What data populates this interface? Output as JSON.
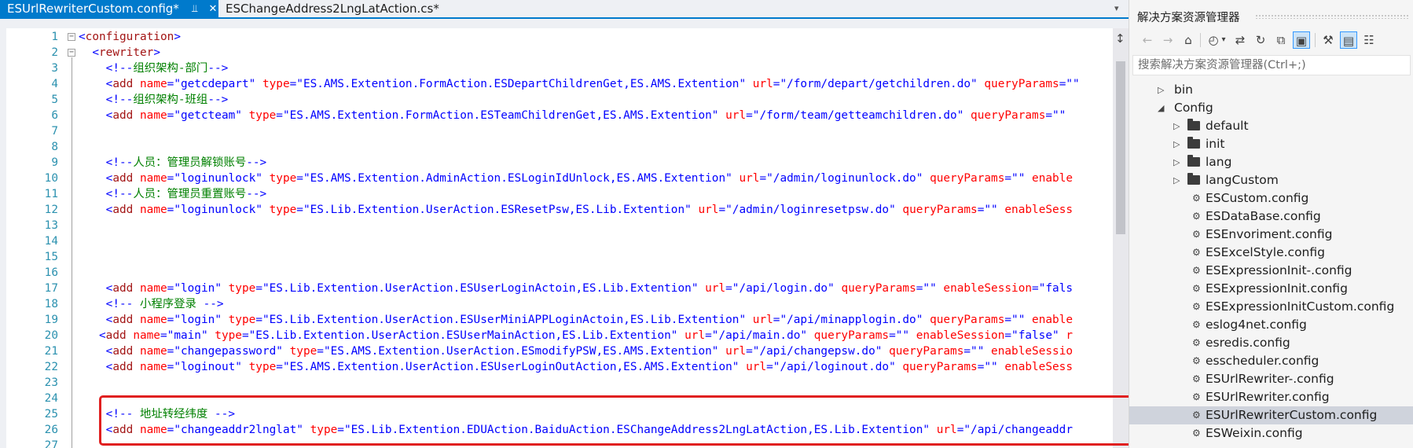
{
  "tabs": [
    {
      "label": "ESUrlRewriterCustom.config*",
      "pin_icon": "pin-icon",
      "close_icon": "close-icon",
      "active": true
    },
    {
      "label": "ESChangeAddress2LngLatAction.cs*",
      "active": false
    }
  ],
  "editor": {
    "lines": [
      {
        "n": "1",
        "parts": [
          [
            "brk",
            "<"
          ],
          [
            "tag",
            "configuration"
          ],
          [
            "brk",
            ">"
          ]
        ]
      },
      {
        "n": "2",
        "parts": [
          [
            "brk",
            "  <"
          ],
          [
            "tag",
            "rewriter"
          ],
          [
            "brk",
            ">"
          ]
        ]
      },
      {
        "n": "3",
        "parts": [
          [
            "brk",
            "    <!--"
          ],
          [
            "cmt",
            "组织架构-部门"
          ],
          [
            "brk",
            "-->"
          ]
        ]
      },
      {
        "n": "4",
        "parts": [
          [
            "brk",
            "    <"
          ],
          [
            "tag",
            "add"
          ],
          [
            "attr",
            " name"
          ],
          [
            "brk",
            "=\""
          ],
          [
            "val",
            "getcdepart"
          ],
          [
            "brk",
            "\""
          ],
          [
            "attr",
            " type"
          ],
          [
            "brk",
            "=\""
          ],
          [
            "val",
            "ES.AMS.Extention.FormAction.ESDepartChildrenGet,ES.AMS.Extention"
          ],
          [
            "brk",
            "\""
          ],
          [
            "attr",
            " url"
          ],
          [
            "brk",
            "=\""
          ],
          [
            "val",
            "/form/depart/getchildren.do"
          ],
          [
            "brk",
            "\""
          ],
          [
            "attr",
            " queryParams"
          ],
          [
            "brk",
            "=\"\""
          ]
        ]
      },
      {
        "n": "5",
        "parts": [
          [
            "brk",
            "    <!--"
          ],
          [
            "cmt",
            "组织架构-班组"
          ],
          [
            "brk",
            "-->"
          ]
        ]
      },
      {
        "n": "6",
        "parts": [
          [
            "brk",
            "    <"
          ],
          [
            "tag",
            "add"
          ],
          [
            "attr",
            " name"
          ],
          [
            "brk",
            "=\""
          ],
          [
            "val",
            "getcteam"
          ],
          [
            "brk",
            "\""
          ],
          [
            "attr",
            " type"
          ],
          [
            "brk",
            "=\""
          ],
          [
            "val",
            "ES.AMS.Extention.FormAction.ESTeamChildrenGet,ES.AMS.Extention"
          ],
          [
            "brk",
            "\""
          ],
          [
            "attr",
            " url"
          ],
          [
            "brk",
            "=\""
          ],
          [
            "val",
            "/form/team/getteamchildren.do"
          ],
          [
            "brk",
            "\""
          ],
          [
            "attr",
            " queryParams"
          ],
          [
            "brk",
            "=\"\""
          ]
        ]
      },
      {
        "n": "7",
        "parts": []
      },
      {
        "n": "8",
        "parts": []
      },
      {
        "n": "9",
        "parts": [
          [
            "brk",
            "    <!--"
          ],
          [
            "cmt",
            "人员：管理员解锁账号"
          ],
          [
            "brk",
            "-->"
          ]
        ]
      },
      {
        "n": "10",
        "parts": [
          [
            "brk",
            "    <"
          ],
          [
            "tag",
            "add"
          ],
          [
            "attr",
            " name"
          ],
          [
            "brk",
            "=\""
          ],
          [
            "val",
            "loginunlock"
          ],
          [
            "brk",
            "\""
          ],
          [
            "attr",
            " type"
          ],
          [
            "brk",
            "=\""
          ],
          [
            "val",
            "ES.AMS.Extention.AdminAction.ESLoginIdUnlock,ES.AMS.Extention"
          ],
          [
            "brk",
            "\""
          ],
          [
            "attr",
            " url"
          ],
          [
            "brk",
            "=\""
          ],
          [
            "val",
            "/admin/loginunlock.do"
          ],
          [
            "brk",
            "\""
          ],
          [
            "attr",
            " queryParams"
          ],
          [
            "brk",
            "=\"\""
          ],
          [
            "attr",
            " enable"
          ]
        ]
      },
      {
        "n": "11",
        "parts": [
          [
            "brk",
            "    <!--"
          ],
          [
            "cmt",
            "人员：管理员重置账号"
          ],
          [
            "brk",
            "-->"
          ]
        ]
      },
      {
        "n": "12",
        "parts": [
          [
            "brk",
            "    <"
          ],
          [
            "tag",
            "add"
          ],
          [
            "attr",
            " name"
          ],
          [
            "brk",
            "=\""
          ],
          [
            "val",
            "loginunlock"
          ],
          [
            "brk",
            "\""
          ],
          [
            "attr",
            " type"
          ],
          [
            "brk",
            "=\""
          ],
          [
            "val",
            "ES.Lib.Extention.UserAction.ESResetPsw,ES.Lib.Extention"
          ],
          [
            "brk",
            "\""
          ],
          [
            "attr",
            " url"
          ],
          [
            "brk",
            "=\""
          ],
          [
            "val",
            "/admin/loginresetpsw.do"
          ],
          [
            "brk",
            "\""
          ],
          [
            "attr",
            " queryParams"
          ],
          [
            "brk",
            "=\"\""
          ],
          [
            "attr",
            " enableSess"
          ]
        ]
      },
      {
        "n": "13",
        "parts": []
      },
      {
        "n": "14",
        "parts": []
      },
      {
        "n": "15",
        "parts": []
      },
      {
        "n": "16",
        "parts": []
      },
      {
        "n": "17",
        "parts": [
          [
            "brk",
            "    <"
          ],
          [
            "tag",
            "add"
          ],
          [
            "attr",
            " name"
          ],
          [
            "brk",
            "=\""
          ],
          [
            "val",
            "login"
          ],
          [
            "brk",
            "\""
          ],
          [
            "attr",
            " type"
          ],
          [
            "brk",
            "=\""
          ],
          [
            "val",
            "ES.Lib.Extention.UserAction.ESUserLoginActoin,ES.Lib.Extention"
          ],
          [
            "brk",
            "\""
          ],
          [
            "attr",
            " url"
          ],
          [
            "brk",
            "=\""
          ],
          [
            "val",
            "/api/login.do"
          ],
          [
            "brk",
            "\""
          ],
          [
            "attr",
            " queryParams"
          ],
          [
            "brk",
            "=\"\""
          ],
          [
            "attr",
            " enableSession"
          ],
          [
            "brk",
            "=\""
          ],
          [
            "val",
            "fals"
          ]
        ]
      },
      {
        "n": "18",
        "parts": [
          [
            "brk",
            "    <!--"
          ],
          [
            "cmt",
            " 小程序登录 "
          ],
          [
            "brk",
            "-->"
          ]
        ]
      },
      {
        "n": "19",
        "parts": [
          [
            "brk",
            "    <"
          ],
          [
            "tag",
            "add"
          ],
          [
            "attr",
            " name"
          ],
          [
            "brk",
            "=\""
          ],
          [
            "val",
            "login"
          ],
          [
            "brk",
            "\""
          ],
          [
            "attr",
            " type"
          ],
          [
            "brk",
            "=\""
          ],
          [
            "val",
            "ES.Lib.Extention.UserAction.ESUserMiniAPPLoginActoin,ES.Lib.Extention"
          ],
          [
            "brk",
            "\""
          ],
          [
            "attr",
            " url"
          ],
          [
            "brk",
            "=\""
          ],
          [
            "val",
            "/api/minapplogin.do"
          ],
          [
            "brk",
            "\""
          ],
          [
            "attr",
            " queryParams"
          ],
          [
            "brk",
            "=\"\""
          ],
          [
            "attr",
            " enable"
          ]
        ]
      },
      {
        "n": "20",
        "parts": [
          [
            "brk",
            "   <"
          ],
          [
            "tag",
            "add"
          ],
          [
            "attr",
            " name"
          ],
          [
            "brk",
            "=\""
          ],
          [
            "val",
            "main"
          ],
          [
            "brk",
            "\""
          ],
          [
            "attr",
            " type"
          ],
          [
            "brk",
            "=\""
          ],
          [
            "val",
            "ES.Lib.Extention.UserAction.ESUserMainAction,ES.Lib.Extention"
          ],
          [
            "brk",
            "\""
          ],
          [
            "attr",
            " url"
          ],
          [
            "brk",
            "=\""
          ],
          [
            "val",
            "/api/main.do"
          ],
          [
            "brk",
            "\""
          ],
          [
            "attr",
            " queryParams"
          ],
          [
            "brk",
            "=\"\""
          ],
          [
            "attr",
            " enableSession"
          ],
          [
            "brk",
            "=\""
          ],
          [
            "val",
            "false"
          ],
          [
            "brk",
            "\""
          ],
          [
            "attr",
            " r"
          ]
        ]
      },
      {
        "n": "21",
        "parts": [
          [
            "brk",
            "    <"
          ],
          [
            "tag",
            "add"
          ],
          [
            "attr",
            " name"
          ],
          [
            "brk",
            "=\""
          ],
          [
            "val",
            "changepassword"
          ],
          [
            "brk",
            "\""
          ],
          [
            "attr",
            " type"
          ],
          [
            "brk",
            "=\""
          ],
          [
            "val",
            "ES.AMS.Extention.UserAction.ESmodifyPSW,ES.AMS.Extention"
          ],
          [
            "brk",
            "\""
          ],
          [
            "attr",
            " url"
          ],
          [
            "brk",
            "=\""
          ],
          [
            "val",
            "/api/changepsw.do"
          ],
          [
            "brk",
            "\""
          ],
          [
            "attr",
            " queryParams"
          ],
          [
            "brk",
            "=\"\""
          ],
          [
            "attr",
            " enableSessio"
          ]
        ]
      },
      {
        "n": "22",
        "parts": [
          [
            "brk",
            "    <"
          ],
          [
            "tag",
            "add"
          ],
          [
            "attr",
            " name"
          ],
          [
            "brk",
            "=\""
          ],
          [
            "val",
            "loginout"
          ],
          [
            "brk",
            "\""
          ],
          [
            "attr",
            " type"
          ],
          [
            "brk",
            "=\""
          ],
          [
            "val",
            "ES.AMS.Extention.UserAction.ESUserLoginOutAction,ES.AMS.Extention"
          ],
          [
            "brk",
            "\""
          ],
          [
            "attr",
            " url"
          ],
          [
            "brk",
            "=\""
          ],
          [
            "val",
            "/api/loginout.do"
          ],
          [
            "brk",
            "\""
          ],
          [
            "attr",
            " queryParams"
          ],
          [
            "brk",
            "=\"\""
          ],
          [
            "attr",
            " enableSess"
          ]
        ]
      },
      {
        "n": "23",
        "parts": []
      },
      {
        "n": "24",
        "parts": []
      },
      {
        "n": "25",
        "parts": [
          [
            "brk",
            "    <!--"
          ],
          [
            "cmt",
            " 地址转经纬度 "
          ],
          [
            "brk",
            "-->"
          ]
        ]
      },
      {
        "n": "26",
        "parts": [
          [
            "brk",
            "    <"
          ],
          [
            "tag",
            "add"
          ],
          [
            "attr",
            " name"
          ],
          [
            "brk",
            "=\""
          ],
          [
            "val",
            "changeaddr2lnglat"
          ],
          [
            "brk",
            "\""
          ],
          [
            "attr",
            " type"
          ],
          [
            "brk",
            "=\""
          ],
          [
            "val",
            "ES.Lib.Extention.EDUAction.BaiduAction.ESChangeAddress2LngLatAction,ES.Lib.Extention"
          ],
          [
            "brk",
            "\""
          ],
          [
            "attr",
            " url"
          ],
          [
            "brk",
            "=\""
          ],
          [
            "val",
            "/api/changeaddr"
          ]
        ]
      },
      {
        "n": "27",
        "parts": []
      }
    ]
  },
  "explorer": {
    "title": "解决方案资源管理器",
    "search_placeholder": "搜索解决方案资源管理器(Ctrl+;)",
    "toolbar_icons": [
      "back-icon",
      "forward-icon",
      "home-icon",
      "history-icon",
      "dropdown-icon",
      "sync-icon",
      "refresh-icon",
      "collapse-all-icon",
      "show-all-files-icon",
      "properties-icon",
      "preview-icon",
      "class-view-icon"
    ],
    "tree": [
      {
        "label": "bin",
        "kind": "folder",
        "depth": 0,
        "expanded": false
      },
      {
        "label": "Config",
        "kind": "folder",
        "depth": 0,
        "expanded": true
      },
      {
        "label": "default",
        "kind": "folder",
        "depth": 1,
        "expanded": false
      },
      {
        "label": "init",
        "kind": "folder",
        "depth": 1,
        "expanded": false
      },
      {
        "label": "lang",
        "kind": "folder",
        "depth": 1,
        "expanded": false
      },
      {
        "label": "langCustom",
        "kind": "folder",
        "depth": 1,
        "expanded": false
      },
      {
        "label": "ESCustom.config",
        "kind": "file",
        "depth": 1
      },
      {
        "label": "ESDataBase.config",
        "kind": "file",
        "depth": 1
      },
      {
        "label": "ESEnvoriment.config",
        "kind": "file",
        "depth": 1
      },
      {
        "label": "ESExcelStyle.config",
        "kind": "file",
        "depth": 1
      },
      {
        "label": "ESExpressionInit-.config",
        "kind": "file",
        "depth": 1
      },
      {
        "label": "ESExpressionInit.config",
        "kind": "file",
        "depth": 1
      },
      {
        "label": "ESExpressionInitCustom.config",
        "kind": "file",
        "depth": 1
      },
      {
        "label": "eslog4net.config",
        "kind": "file",
        "depth": 1
      },
      {
        "label": "esredis.config",
        "kind": "file",
        "depth": 1
      },
      {
        "label": "esscheduler.config",
        "kind": "file",
        "depth": 1
      },
      {
        "label": "ESUrlRewriter-.config",
        "kind": "file",
        "depth": 1
      },
      {
        "label": "ESUrlRewriter.config",
        "kind": "file",
        "depth": 1
      },
      {
        "label": "ESUrlRewriterCustom.config",
        "kind": "file",
        "depth": 1,
        "selected": true
      },
      {
        "label": "ESWeixin.config",
        "kind": "file",
        "depth": 1
      }
    ]
  }
}
